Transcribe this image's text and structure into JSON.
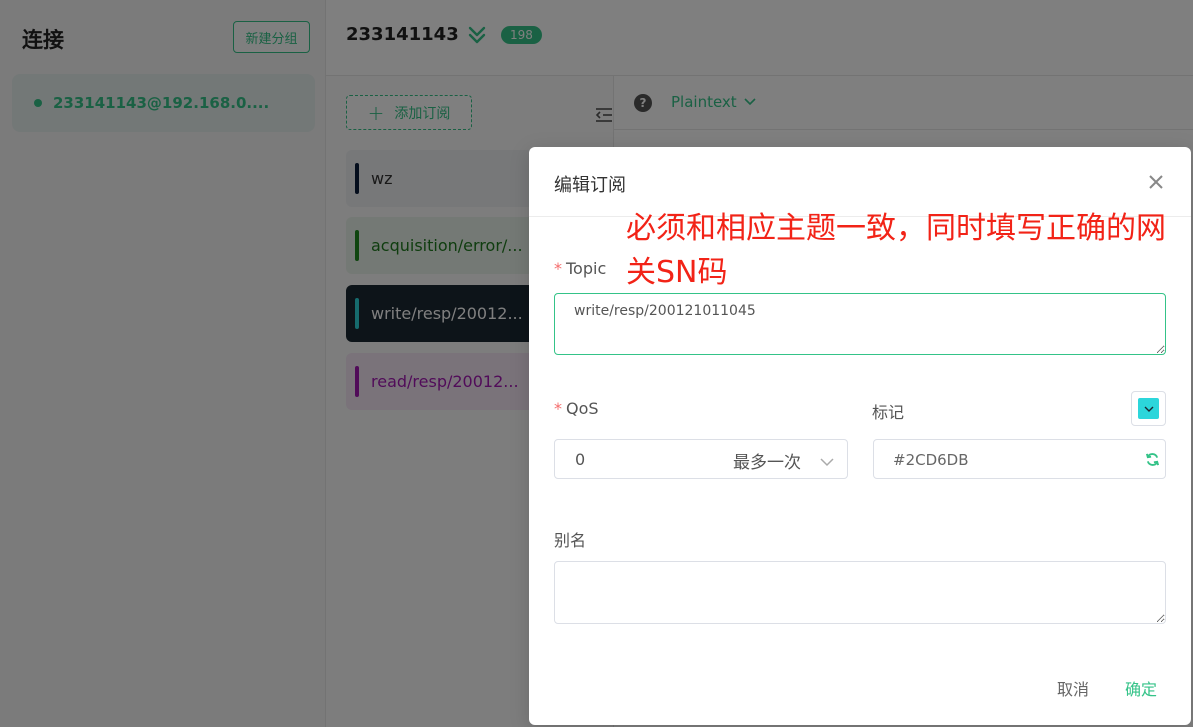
{
  "left_panel": {
    "title": "连接",
    "new_group_label": "新建分组",
    "connection": {
      "label": "233141143@192.168.0....",
      "status_color": "#34c388"
    }
  },
  "header": {
    "connection_name": "233141143",
    "message_count": "198"
  },
  "subscriptions": {
    "add_label": "添加订阅",
    "items": [
      {
        "topic": "wz",
        "color": "#0b1c3a",
        "bg": "#eef0f2",
        "text_color": "#333333"
      },
      {
        "topic": "acquisition/error/...",
        "color": "#1f8a1f",
        "bg": "#e9f3ea",
        "text_color": "#1f7a1f"
      },
      {
        "topic": "write/resp/20012...",
        "color": "#2cd6db",
        "bg": "#1b2832",
        "text_color": "#ffffff"
      },
      {
        "topic": "read/resp/20012...",
        "color": "#a319b3",
        "bg": "#f4e6f5",
        "text_color": "#a319b3"
      }
    ]
  },
  "payload_bar": {
    "format": "Plaintext"
  },
  "dialog": {
    "title": "编辑订阅",
    "annotation": "必须和相应主题一致，同时填写正确的网关SN码",
    "topic": {
      "label": "Topic",
      "value": "write/resp/200121011045"
    },
    "qos": {
      "label": "QoS",
      "value": "0",
      "description": "最多一次"
    },
    "color": {
      "label": "标记",
      "value": "#2CD6DB",
      "swatch": "#2cd6db"
    },
    "alias": {
      "label": "别名",
      "value": ""
    },
    "cancel_label": "取消",
    "confirm_label": "确定"
  },
  "accent_color": "#34c388"
}
